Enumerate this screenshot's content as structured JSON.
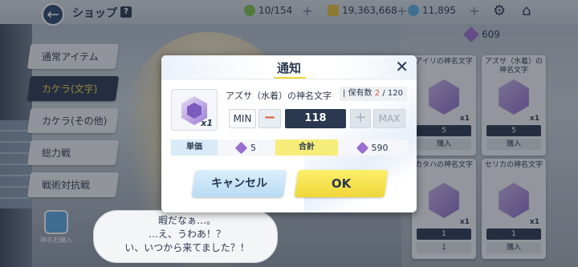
{
  "header": {
    "title": "ショップ",
    "help": "?",
    "ap": "10/154",
    "credits": "19,363,668",
    "gems": "11,895",
    "back_icon": "arrow-left-icon",
    "settings_icon": "gear-icon",
    "home_icon": "home-icon"
  },
  "currency": {
    "pyroxene_shop": "609"
  },
  "sidebar": {
    "items": [
      {
        "label": "通常アイテム"
      },
      {
        "label": "カケラ(文字)"
      },
      {
        "label": "カケラ(その他)"
      },
      {
        "label": "総力戦"
      },
      {
        "label": "戦術対抗戦"
      }
    ],
    "active_index": 1,
    "eleph_button": "神名石購入"
  },
  "cards": [
    {
      "name": "アイリの神名文字",
      "qty": "x1",
      "price": "5",
      "buy": "購入"
    },
    {
      "name": "アズサ（水着）の神名文字",
      "qty": "x1",
      "price": "5",
      "buy": "購入"
    },
    {
      "name": "カタハの神名文字",
      "qty": "x1",
      "price": "1",
      "buy": "1"
    },
    {
      "name": "セリカの神名文字",
      "qty": "x1",
      "price": "1",
      "buy": "購入"
    }
  ],
  "dialog_bubble": {
    "line1": "暇だなぁ…。",
    "line2": "…え、うわあ！？",
    "line3": "い、いつから来てました？！"
  },
  "modal": {
    "title": "通知",
    "close": "✕",
    "item_name": "アズサ（水着）の神名文字",
    "item_count": "x1",
    "owned_label": "保有数",
    "owned_current": "2",
    "owned_max": "/ 120",
    "min_label": "MIN",
    "minus": "−",
    "quantity": "118",
    "plus": "+",
    "max_label": "MAX",
    "unit_price_label": "単価",
    "unit_price": "5",
    "total_label": "合計",
    "total": "590",
    "cancel_label": "キャンセル",
    "ok_label": "OK"
  }
}
